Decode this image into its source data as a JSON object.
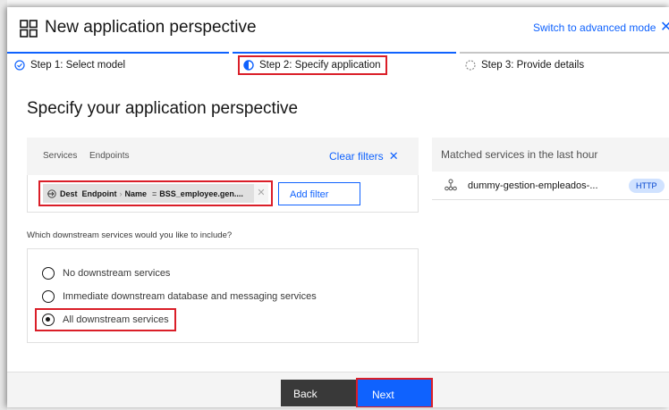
{
  "header": {
    "title": "New application perspective",
    "advanced_link": "Switch to advanced mode"
  },
  "steps": [
    {
      "label": "Step 1: Select model",
      "state": "complete"
    },
    {
      "label": "Step 2: Specify application",
      "state": "current"
    },
    {
      "label": "Step 3: Provide details",
      "state": "incomplete"
    }
  ],
  "section_title": "Specify your application perspective",
  "filter": {
    "tabs": [
      "Services",
      "Endpoints"
    ],
    "clear_label": "Clear filters",
    "pill": {
      "prefix": "Dest",
      "entity": "Endpoint",
      "attribute": "Name",
      "operator": "=",
      "value": "BSS_employee.gen...."
    },
    "add_label": "Add filter"
  },
  "matched": {
    "title": "Matched services in the last hour",
    "items": [
      {
        "name": "dummy-gestion-empleados-...",
        "badge": "HTTP"
      }
    ]
  },
  "downstream": {
    "question": "Which downstream services would you like to include?",
    "options": [
      {
        "label": "No downstream services",
        "selected": false
      },
      {
        "label": "Immediate downstream database and messaging services",
        "selected": false
      },
      {
        "label": "All downstream services",
        "selected": true
      }
    ]
  },
  "footer": {
    "back_label": "Back",
    "next_label": "Next"
  },
  "colors": {
    "accent": "#0f62fe",
    "highlight": "#da1e28",
    "badge_bg": "#d0e2ff"
  }
}
